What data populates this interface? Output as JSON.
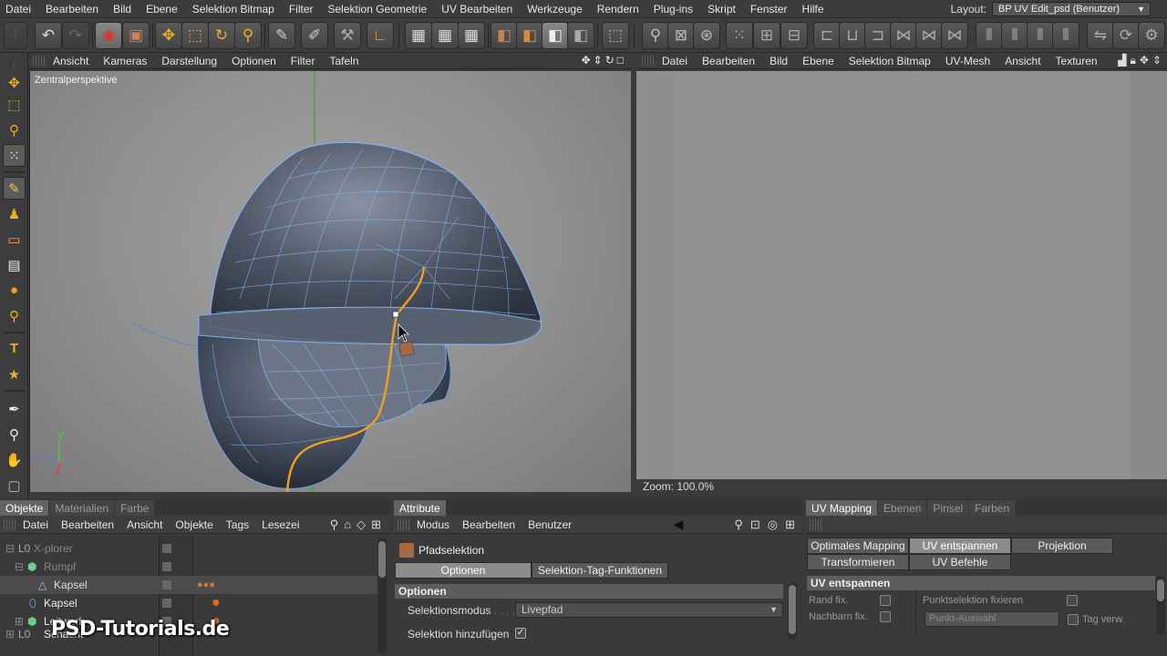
{
  "menubar": {
    "items": [
      "Datei",
      "Bearbeiten",
      "Bild",
      "Ebene",
      "Selektion Bitmap",
      "Filter",
      "Selektion Geometrie",
      "UV Bearbeiten",
      "Werkzeuge",
      "Rendern",
      "Plug-ins",
      "Skript",
      "Fenster",
      "Hilfe"
    ],
    "layout_label": "Layout:",
    "layout_value": "BP UV Edit_psd (Benutzer)"
  },
  "viewport": {
    "menu": [
      "Ansicht",
      "Kameras",
      "Darstellung",
      "Optionen",
      "Filter",
      "Tafeln"
    ],
    "label": "Zentralperspektive",
    "axis_labels": {
      "y": "Y",
      "x": "X",
      "z": "Z"
    }
  },
  "uv_view": {
    "menu": [
      "Datei",
      "Bearbeiten",
      "Bild",
      "Ebene",
      "Selektion Bitmap",
      "UV-Mesh",
      "Ansicht",
      "Texturen"
    ],
    "zoom": "Zoom: 100.0%"
  },
  "objects_panel": {
    "tabs": [
      "Objekte",
      "Materialien",
      "Farbe"
    ],
    "menu": [
      "Datei",
      "Bearbeiten",
      "Ansicht",
      "Objekte",
      "Tags",
      "Lesezei"
    ],
    "tree": [
      {
        "name": "X-plorer",
        "indent": 0,
        "icon": "null-icon"
      },
      {
        "name": "Rumpf",
        "indent": 1,
        "icon": "symmetry-icon"
      },
      {
        "name": "Kapsel",
        "indent": 2,
        "icon": "polygon-object-icon"
      },
      {
        "name": "Kapsel",
        "indent": 1,
        "icon": "capsule-icon"
      },
      {
        "name": "Leitwerk",
        "indent": 1,
        "icon": "symmetry-icon"
      },
      {
        "name": "Schacht",
        "indent": 0,
        "icon": "null-icon"
      }
    ]
  },
  "attributes_panel": {
    "tab": "Attribute",
    "menu": [
      "Modus",
      "Bearbeiten",
      "Benutzer"
    ],
    "tool_name": "Pfadselektion",
    "subtabs": [
      "Optionen",
      "Selektion-Tag-Funktionen"
    ],
    "section": "Optionen",
    "fields": {
      "mode_label": "Selektionsmodus",
      "mode_value": "Livepfad",
      "add_label": "Selektion hinzufügen",
      "add_checked": true
    }
  },
  "uv_panel": {
    "tabs": [
      "UV Mapping",
      "Ebenen",
      "Pinsel",
      "Farben"
    ],
    "buttons_row1": [
      "Optimales Mapping",
      "UV entspannen",
      "Projektion"
    ],
    "buttons_row2": [
      "Transformieren",
      "UV Befehle"
    ],
    "section": "UV entspannen",
    "options": {
      "rand_fix": "Rand fix.",
      "nachbarn_fix": "Nachbarn fix.",
      "punkt_fix": "Punktselektion fixieren",
      "punkt_btn": "Punkt-Auswahl",
      "tag_verw": "Tag verw."
    }
  },
  "watermark": "PSD-Tutorials.de",
  "colors": {
    "accent_path": "#f0a020",
    "wire": "#7db3ff",
    "bg": "#3a3a3a"
  }
}
